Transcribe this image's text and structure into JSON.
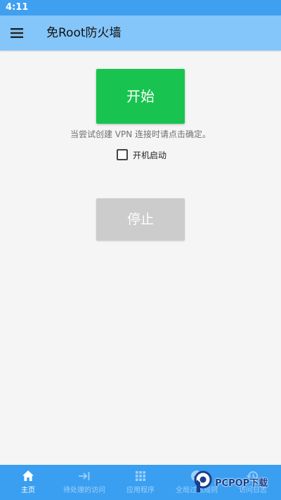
{
  "status_bar": {
    "time": "4:11"
  },
  "app_bar": {
    "title": "免Root防火墙",
    "menu_icon": "menu-icon"
  },
  "main": {
    "start_label": "开始",
    "hint": "当尝试创建 VPN 连接时请点击确定。",
    "autostart_label": "开机启动",
    "autostart_checked": false,
    "stop_label": "停止"
  },
  "bottom_nav": {
    "items": [
      {
        "label": "主页",
        "icon": "home-icon",
        "active": true
      },
      {
        "label": "待处理的访问",
        "icon": "arrow-to-bar-icon",
        "active": false
      },
      {
        "label": "应用程序",
        "icon": "grid-icon",
        "active": false
      },
      {
        "label": "全局过滤规则",
        "icon": "check-circle-icon",
        "active": false
      },
      {
        "label": "访问日志",
        "icon": "history-icon",
        "active": false
      }
    ]
  },
  "watermark": {
    "text": "PCPOP下载"
  },
  "colors": {
    "status_bar": "#3f9ff0",
    "app_bar": "#84c5fa",
    "start_button": "#18c44f",
    "stop_button": "#cccccc",
    "bottom_nav": "#3a9ff0",
    "background": "#f5f5f5"
  }
}
